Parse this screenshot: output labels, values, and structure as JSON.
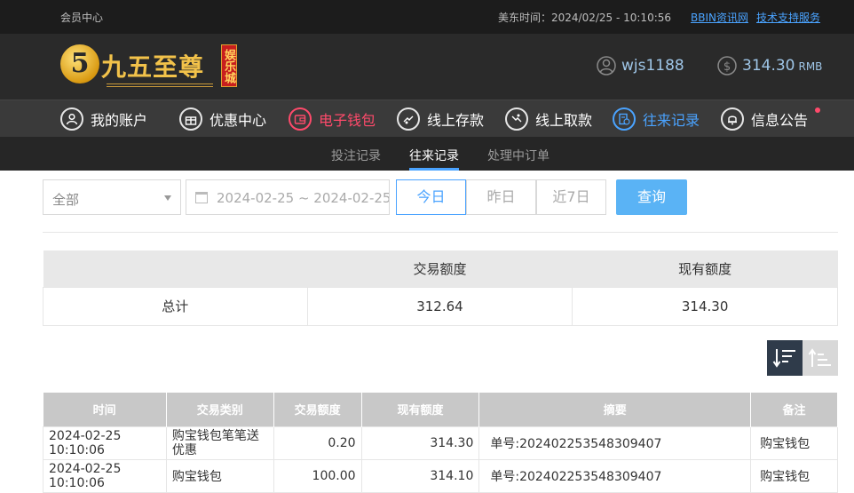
{
  "topbar": {
    "member_center": "会员中心",
    "time_label": "美东时间：2024/02/25 - 10:10:56",
    "links": [
      "BBIN资讯网",
      "技术支持服务"
    ]
  },
  "header": {
    "logo_digit": "5",
    "logo_name": "九五至尊",
    "logo_badge": "娱乐城",
    "username": "wjs1188",
    "balance": "314.30",
    "currency": "RMB"
  },
  "nav": {
    "items": [
      {
        "label": "我的账户",
        "icon": "user-icon"
      },
      {
        "label": "优惠中心",
        "icon": "gift-icon"
      },
      {
        "label": "电子钱包",
        "icon": "wallet-icon"
      },
      {
        "label": "线上存款",
        "icon": "deposit-icon"
      },
      {
        "label": "线上取款",
        "icon": "withdraw-icon"
      },
      {
        "label": "往来记录",
        "icon": "records-icon"
      },
      {
        "label": "信息公告",
        "icon": "bell-icon"
      }
    ]
  },
  "subnav": {
    "tabs": [
      "投注记录",
      "往来记录",
      "处理中订单"
    ],
    "active": "往来记录"
  },
  "filters": {
    "type_value": "全部",
    "date_range": "2024-02-25 ~ 2024-02-25",
    "quick": [
      "今日",
      "昨日",
      "近7日"
    ],
    "search_label": "查询"
  },
  "summary": {
    "headers": [
      "",
      "交易额度",
      "现有额度"
    ],
    "row": [
      "总计",
      "312.64",
      "314.30"
    ]
  },
  "records": {
    "headers": [
      "时间",
      "交易类别",
      "交易额度",
      "现有额度",
      "摘要",
      "备注"
    ],
    "rows": [
      [
        "2024-02-25 10:10:06",
        "购宝钱包笔笔送优惠",
        "0.20",
        "314.30",
        "单号:202402253548309407",
        "购宝钱包"
      ],
      [
        "2024-02-25 10:10:06",
        "购宝钱包",
        "100.00",
        "314.10",
        "单号:202402253548309407",
        "购宝钱包"
      ]
    ]
  },
  "colors": {
    "accent_blue": "#4aa3ff",
    "accent_red": "#ff4a6b",
    "search_btn": "#5ab3f5"
  }
}
